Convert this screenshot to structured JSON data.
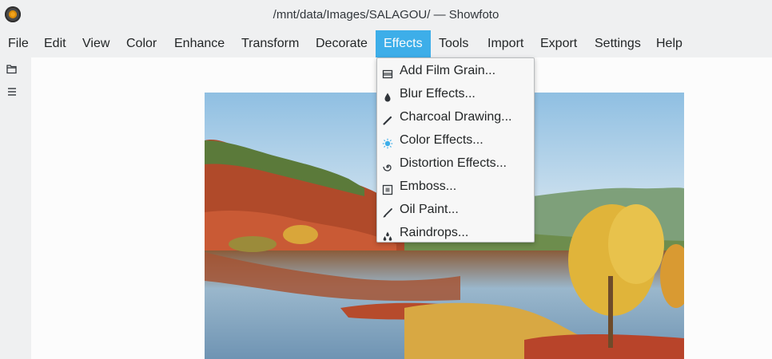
{
  "window": {
    "title": "/mnt/data/Images/SALAGOU/ — Showfoto"
  },
  "menubar": {
    "items": [
      {
        "label": "File"
      },
      {
        "label": "Edit"
      },
      {
        "label": "View"
      },
      {
        "label": "Color"
      },
      {
        "label": "Enhance"
      },
      {
        "label": "Transform"
      },
      {
        "label": "Decorate"
      },
      {
        "label": "Effects"
      },
      {
        "label": "Tools"
      },
      {
        "label": "Import"
      },
      {
        "label": "Export"
      },
      {
        "label": "Settings"
      },
      {
        "label": "Help"
      }
    ],
    "active": "Effects"
  },
  "effects_menu": {
    "items": [
      {
        "label": "Add Film Grain...",
        "icon": "film-grain-icon"
      },
      {
        "label": "Blur Effects...",
        "icon": "blur-drop-icon"
      },
      {
        "label": "Charcoal Drawing...",
        "icon": "pencil-icon"
      },
      {
        "label": "Color Effects...",
        "icon": "color-burst-icon"
      },
      {
        "label": "Distortion Effects...",
        "icon": "spiral-icon"
      },
      {
        "label": "Emboss...",
        "icon": "emboss-icon"
      },
      {
        "label": "Oil Paint...",
        "icon": "paintbrush-icon"
      },
      {
        "label": "Raindrops...",
        "icon": "raindrops-icon"
      }
    ]
  },
  "colors": {
    "accent": "#3daee9"
  }
}
